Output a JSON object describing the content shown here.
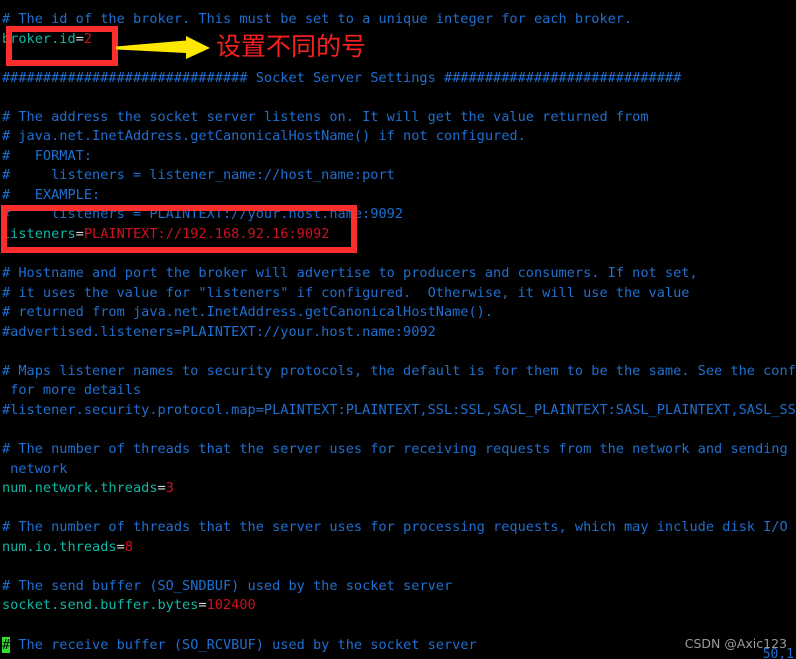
{
  "window": {
    "kind": "terminal-text-editor",
    "background_color": "#000000",
    "comment_color": "#1f6fd0",
    "key_color": "#0fb6a6",
    "value_color": "#cf1020",
    "cursor_color": "#2fe02f",
    "annotation_color": "#fc2d2d",
    "arrow_color": "#ffe800"
  },
  "file": {
    "lines": [
      {
        "type": "comment",
        "text": "# The id of the broker. This must be set to a unique integer for each broker."
      },
      {
        "type": "setting",
        "key": "broker.id",
        "eq": "=",
        "value": "2"
      },
      {
        "type": "blank",
        "text": ""
      },
      {
        "type": "comment",
        "text": "############################## Socket Server Settings #############################"
      },
      {
        "type": "blank",
        "text": ""
      },
      {
        "type": "comment",
        "text": "# The address the socket server listens on. It will get the value returned from"
      },
      {
        "type": "comment",
        "text": "# java.net.InetAddress.getCanonicalHostName() if not configured."
      },
      {
        "type": "comment",
        "text": "#   FORMAT:"
      },
      {
        "type": "comment",
        "text": "#     listeners = listener_name://host_name:port"
      },
      {
        "type": "comment",
        "text": "#   EXAMPLE:"
      },
      {
        "type": "comment",
        "text": "#     listeners = PLAINTEXT://your.host.name:9092"
      },
      {
        "type": "setting",
        "key": "listeners",
        "eq": "=",
        "value": "PLAINTEXT://192.168.92.16:9092"
      },
      {
        "type": "blank",
        "text": ""
      },
      {
        "type": "comment",
        "text": "# Hostname and port the broker will advertise to producers and consumers. If not set,"
      },
      {
        "type": "comment",
        "text": "# it uses the value for \"listeners\" if configured.  Otherwise, it will use the value"
      },
      {
        "type": "comment",
        "text": "# returned from java.net.InetAddress.getCanonicalHostName()."
      },
      {
        "type": "comment",
        "text": "#advertised.listeners=PLAINTEXT://your.host.name:9092"
      },
      {
        "type": "blank",
        "text": ""
      },
      {
        "type": "comment",
        "text": "# Maps listener names to security protocols, the default is for them to be the same. See the config"
      },
      {
        "type": "comment",
        "text": " for more details"
      },
      {
        "type": "comment",
        "text": "#listener.security.protocol.map=PLAINTEXT:PLAINTEXT,SSL:SSL,SASL_PLAINTEXT:SASL_PLAINTEXT,SASL_SSL:"
      },
      {
        "type": "blank",
        "text": ""
      },
      {
        "type": "comment",
        "text": "# The number of threads that the server uses for receiving requests from the network and sending re"
      },
      {
        "type": "comment",
        "text": " network"
      },
      {
        "type": "setting",
        "key": "num.network.threads",
        "eq": "=",
        "value": "3"
      },
      {
        "type": "blank",
        "text": ""
      },
      {
        "type": "comment",
        "text": "# The number of threads that the server uses for processing requests, which may include disk I/O"
      },
      {
        "type": "setting",
        "key": "num.io.threads",
        "eq": "=",
        "value": "8"
      },
      {
        "type": "blank",
        "text": ""
      },
      {
        "type": "comment",
        "text": "# The send buffer (SO_SNDBUF) used by the socket server"
      },
      {
        "type": "setting",
        "key": "socket.send.buffer.bytes",
        "eq": "=",
        "value": "102400"
      },
      {
        "type": "blank",
        "text": ""
      },
      {
        "type": "comment",
        "cursor_first_char": true,
        "text": "# The receive buffer (SO_RCVBUF) used by the socket server"
      }
    ]
  },
  "annotations": {
    "broker_id_box_label": "broker.id highlight box",
    "listeners_box_label": "listeners highlight box",
    "arrow_label": "yellow pointer arrow",
    "chinese_note": "设置不同的号"
  },
  "status": {
    "position_indicator": "50,1",
    "watermark": "CSDN @Axic123"
  }
}
